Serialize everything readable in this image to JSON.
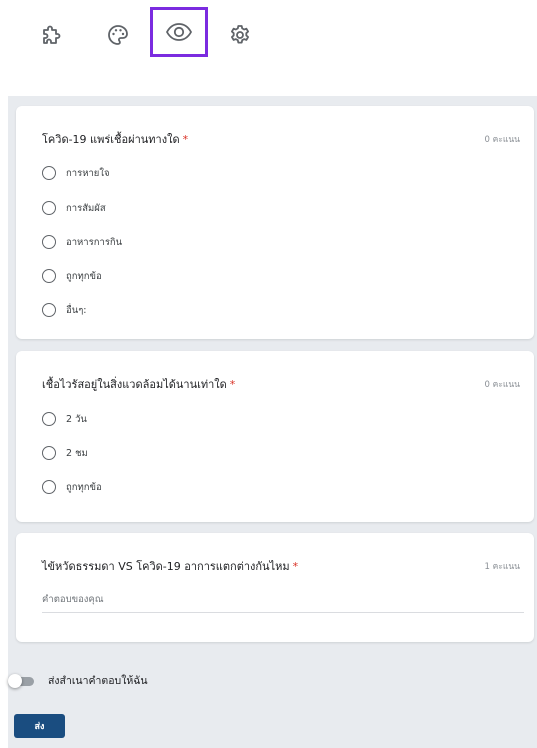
{
  "toolbar": {
    "icons": [
      "add-on-puzzle-icon",
      "palette-icon",
      "preview-eye-icon",
      "settings-gear-icon"
    ],
    "active_icon": "preview-eye-icon",
    "active_color": "#7b2be0"
  },
  "questions": [
    {
      "title": "โควิด-19 แพร่เชื้อผ่านทางใด",
      "required_mark": "*",
      "points": "0 คะแนน",
      "options": [
        "การหายใจ",
        "การสัมผัส",
        "อาหารการกิน",
        "ถูกทุกข้อ",
        "อื่นๆ:"
      ]
    },
    {
      "title": "เชื้อไวรัสอยู่ในสิ่งแวดล้อมได้นานเท่าใด",
      "required_mark": "*",
      "points": "0 คะแนน",
      "options": [
        "2 วัน",
        "2 ชม",
        "ถูกทุกข้อ"
      ]
    },
    {
      "title": "ไข้หวัดธรรมดา VS โควิด-19 อาการแตกต่างกันไหม",
      "required_mark": "*",
      "points": "1 คะแนน",
      "answer_placeholder": "คำตอบของคุณ"
    }
  ],
  "footer": {
    "send_copy_label": "ส่งสำเนาคำตอบให้ฉัน",
    "send_copy_on": false,
    "submit_label": "ส่ง"
  },
  "colors": {
    "accent": "#7b2be0",
    "submit_button": "#1a4d80",
    "required": "#d93025",
    "background": "#e8ebef"
  }
}
